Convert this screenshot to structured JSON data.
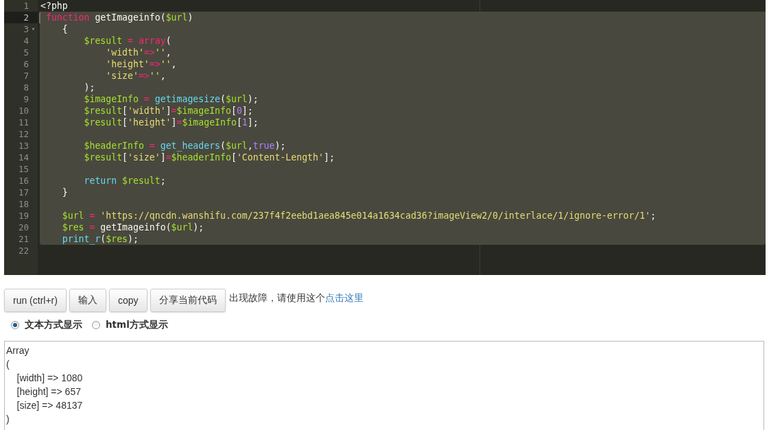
{
  "editor": {
    "lines": [
      {
        "number": "1",
        "selected": false,
        "active": false,
        "tokens": [
          {
            "kind": "plain",
            "text": "<?php"
          }
        ]
      },
      {
        "number": "2",
        "selected": true,
        "active": true,
        "tokens": [
          {
            "kind": "keyword",
            "text": " function"
          },
          {
            "kind": "plain",
            "text": " getImageinfo("
          },
          {
            "kind": "variable",
            "text": "$url"
          },
          {
            "kind": "plain",
            "text": ")"
          }
        ]
      },
      {
        "number": "3",
        "selected": true,
        "active": false,
        "fold": "▾",
        "tokens": [
          {
            "kind": "plain",
            "text": "    {"
          }
        ]
      },
      {
        "number": "4",
        "selected": true,
        "active": false,
        "tokens": [
          {
            "kind": "variable",
            "text": "        $result"
          },
          {
            "kind": "operator",
            "text": " = "
          },
          {
            "kind": "keyword",
            "text": "array"
          },
          {
            "kind": "plain",
            "text": "("
          }
        ]
      },
      {
        "number": "5",
        "selected": true,
        "active": false,
        "tokens": [
          {
            "kind": "string",
            "text": "            'width'"
          },
          {
            "kind": "operator",
            "text": "=>"
          },
          {
            "kind": "string",
            "text": "''"
          },
          {
            "kind": "plain",
            "text": ","
          }
        ]
      },
      {
        "number": "6",
        "selected": true,
        "active": false,
        "tokens": [
          {
            "kind": "string",
            "text": "            'height'"
          },
          {
            "kind": "operator",
            "text": "=>"
          },
          {
            "kind": "string",
            "text": "''"
          },
          {
            "kind": "plain",
            "text": ","
          }
        ]
      },
      {
        "number": "7",
        "selected": true,
        "active": false,
        "tokens": [
          {
            "kind": "string",
            "text": "            'size'"
          },
          {
            "kind": "operator",
            "text": "=>"
          },
          {
            "kind": "string",
            "text": "''"
          },
          {
            "kind": "plain",
            "text": ","
          }
        ]
      },
      {
        "number": "8",
        "selected": true,
        "active": false,
        "tokens": [
          {
            "kind": "plain",
            "text": "        );"
          }
        ]
      },
      {
        "number": "9",
        "selected": true,
        "active": false,
        "tokens": [
          {
            "kind": "variable",
            "text": "        $imageInfo"
          },
          {
            "kind": "operator",
            "text": " = "
          },
          {
            "kind": "function",
            "text": "getimagesize"
          },
          {
            "kind": "plain",
            "text": "("
          },
          {
            "kind": "variable",
            "text": "$url"
          },
          {
            "kind": "plain",
            "text": ");"
          }
        ]
      },
      {
        "number": "10",
        "selected": true,
        "active": false,
        "tokens": [
          {
            "kind": "variable",
            "text": "        $result"
          },
          {
            "kind": "plain",
            "text": "["
          },
          {
            "kind": "string",
            "text": "'width'"
          },
          {
            "kind": "plain",
            "text": "]"
          },
          {
            "kind": "operator",
            "text": "="
          },
          {
            "kind": "variable",
            "text": "$imageInfo"
          },
          {
            "kind": "plain",
            "text": "["
          },
          {
            "kind": "number",
            "text": "0"
          },
          {
            "kind": "plain",
            "text": "];"
          }
        ]
      },
      {
        "number": "11",
        "selected": true,
        "active": false,
        "tokens": [
          {
            "kind": "variable",
            "text": "        $result"
          },
          {
            "kind": "plain",
            "text": "["
          },
          {
            "kind": "string",
            "text": "'height'"
          },
          {
            "kind": "plain",
            "text": "]"
          },
          {
            "kind": "operator",
            "text": "="
          },
          {
            "kind": "variable",
            "text": "$imageInfo"
          },
          {
            "kind": "plain",
            "text": "["
          },
          {
            "kind": "number",
            "text": "1"
          },
          {
            "kind": "plain",
            "text": "];"
          }
        ]
      },
      {
        "number": "12",
        "selected": true,
        "active": false
      },
      {
        "number": "13",
        "selected": true,
        "active": false,
        "tokens": [
          {
            "kind": "variable",
            "text": "        $headerInfo"
          },
          {
            "kind": "operator",
            "text": " = "
          },
          {
            "kind": "function",
            "text": "get_headers"
          },
          {
            "kind": "plain",
            "text": "("
          },
          {
            "kind": "variable",
            "text": "$url"
          },
          {
            "kind": "plain",
            "text": ","
          },
          {
            "kind": "number",
            "text": "true"
          },
          {
            "kind": "plain",
            "text": ");"
          }
        ]
      },
      {
        "number": "14",
        "selected": true,
        "active": false,
        "tokens": [
          {
            "kind": "variable",
            "text": "        $result"
          },
          {
            "kind": "plain",
            "text": "["
          },
          {
            "kind": "string",
            "text": "'size'"
          },
          {
            "kind": "plain",
            "text": "]"
          },
          {
            "kind": "operator",
            "text": "="
          },
          {
            "kind": "variable",
            "text": "$headerInfo"
          },
          {
            "kind": "plain",
            "text": "["
          },
          {
            "kind": "string",
            "text": "'Content-Length'"
          },
          {
            "kind": "plain",
            "text": "];"
          }
        ]
      },
      {
        "number": "15",
        "selected": true,
        "active": false
      },
      {
        "number": "16",
        "selected": true,
        "active": false,
        "tokens": [
          {
            "kind": "function",
            "text": "        return"
          },
          {
            "kind": "variable",
            "text": " $result"
          },
          {
            "kind": "plain",
            "text": ";"
          }
        ]
      },
      {
        "number": "17",
        "selected": true,
        "active": false,
        "tokens": [
          {
            "kind": "plain",
            "text": "    }"
          }
        ]
      },
      {
        "number": "18",
        "selected": true,
        "active": false
      },
      {
        "number": "19",
        "selected": true,
        "active": false,
        "tokens": [
          {
            "kind": "variable",
            "text": "    $url"
          },
          {
            "kind": "operator",
            "text": " = "
          },
          {
            "kind": "string",
            "text": "'https://qncdn.wanshifu.com/237f4f2eebd1aea845e014a1634cad36?imageView2/0/interlace/1/ignore-error/1'"
          },
          {
            "kind": "plain",
            "text": ";"
          }
        ]
      },
      {
        "number": "20",
        "selected": true,
        "active": false,
        "tokens": [
          {
            "kind": "variable",
            "text": "    $res"
          },
          {
            "kind": "operator",
            "text": " = "
          },
          {
            "kind": "plain",
            "text": "getImageinfo("
          },
          {
            "kind": "variable",
            "text": "$url"
          },
          {
            "kind": "plain",
            "text": ");"
          }
        ]
      },
      {
        "number": "21",
        "selected": true,
        "active": false,
        "tokens": [
          {
            "kind": "function",
            "text": "    print_r"
          },
          {
            "kind": "plain",
            "text": "("
          },
          {
            "kind": "variable",
            "text": "$res"
          },
          {
            "kind": "plain",
            "text": ");"
          }
        ]
      },
      {
        "number": "22",
        "selected": false,
        "active": false
      }
    ]
  },
  "buttons": [
    "run (ctrl+r)",
    "输入",
    "copy",
    "分享当前代码"
  ],
  "notice": {
    "text": "出现故障，请使用这个",
    "link": "点击这里"
  },
  "display_modes": [
    {
      "label": "文本方式显示",
      "selected": true
    },
    {
      "label": "html方式显示",
      "selected": false
    }
  ],
  "output": {
    "lines": [
      "Array",
      "(",
      "    [width] => 1080",
      "    [height] => 657",
      "    [size] => 48137",
      ")"
    ]
  }
}
